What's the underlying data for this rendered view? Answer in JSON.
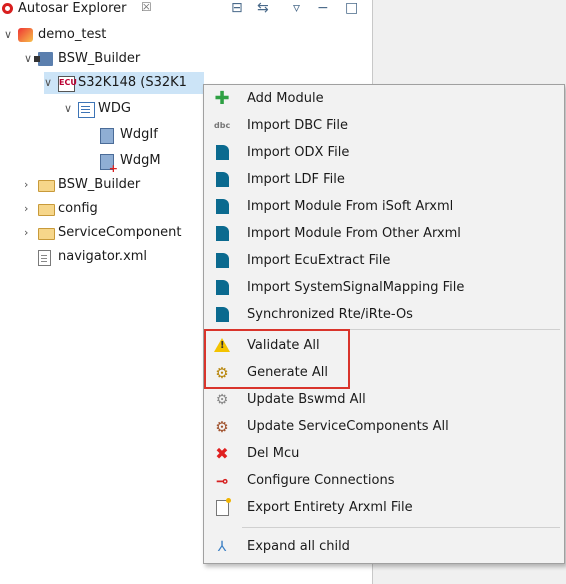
{
  "view": {
    "title": "Autosar Explorer",
    "close_glyph": "☒",
    "toolbar": [
      {
        "icon": "collapse-all-icon",
        "glyph": "⊟"
      },
      {
        "icon": "link-with-editor-icon",
        "glyph": "⇆"
      },
      {
        "icon": "view-menu-icon",
        "glyph": "▿"
      },
      {
        "icon": "minimize-icon",
        "glyph": "−"
      },
      {
        "icon": "maximize-icon",
        "glyph": "□"
      }
    ]
  },
  "tree": {
    "chevron_open": "∨",
    "chevron_closed": "›",
    "items": [
      {
        "label": "demo_test",
        "icon": "project-icon"
      },
      {
        "label": "BSW_Builder",
        "icon": "package-icon"
      },
      {
        "label": "S32K148 (S32K1",
        "icon": "ecu-icon",
        "icon_text": "ECU"
      },
      {
        "label": "WDG",
        "icon": "module-list-icon"
      },
      {
        "label": "WdgIf",
        "icon": "document-icon"
      },
      {
        "label": "WdgM",
        "icon": "document-modified-icon"
      },
      {
        "label": "BSW_Builder",
        "icon": "folder-icon"
      },
      {
        "label": "config",
        "icon": "folder-icon"
      },
      {
        "label": "ServiceComponent",
        "icon": "folder-icon"
      },
      {
        "label": "navigator.xml",
        "icon": "file-icon"
      }
    ]
  },
  "context_menu": {
    "items": [
      {
        "label": "Add Module",
        "icon": "add-icon",
        "glyph": "✚"
      },
      {
        "label": "Import DBC File",
        "icon": "dbc-icon",
        "glyph": "dbc"
      },
      {
        "label": "Import ODX File",
        "icon": "teal-document-icon"
      },
      {
        "label": "Import LDF File",
        "icon": "teal-document-icon"
      },
      {
        "label": "Import Module From iSoft Arxml",
        "icon": "teal-document-icon"
      },
      {
        "label": "Import Module From Other Arxml",
        "icon": "teal-document-icon"
      },
      {
        "label": "Import EcuExtract File",
        "icon": "teal-document-icon"
      },
      {
        "label": "Import SystemSignalMapping File",
        "icon": "teal-document-icon"
      },
      {
        "label": "Synchronized Rte/iRte-Os",
        "icon": "teal-document-icon"
      },
      {
        "label": "Validate All",
        "icon": "warning-icon"
      },
      {
        "label": "Generate All",
        "icon": "gears-icon",
        "glyph": "⚙"
      },
      {
        "label": "Update Bswmd All",
        "icon": "update-gear-icon",
        "glyph": "⚙"
      },
      {
        "label": "Update ServiceComponents All",
        "icon": "update-components-icon",
        "glyph": "⚙"
      },
      {
        "label": "Del Mcu",
        "icon": "delete-icon",
        "glyph": "✖"
      },
      {
        "label": "Configure Connections",
        "icon": "connection-icon",
        "glyph": "⊸"
      },
      {
        "label": "Export Entirety Arxml File",
        "icon": "export-file-icon"
      },
      {
        "label": "Expand all child",
        "icon": "expand-tree-icon",
        "glyph": "⅄"
      }
    ]
  },
  "colors": {
    "selection": "#cce4f7",
    "highlight_border": "#d9342b",
    "menu_background": "#f2f2f2"
  }
}
